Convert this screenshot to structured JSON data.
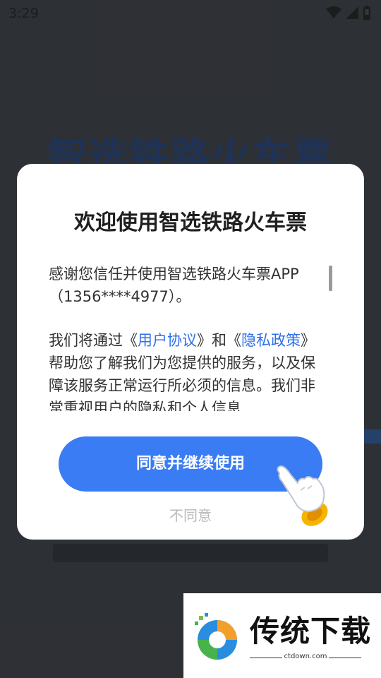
{
  "status_bar": {
    "time": "3:29",
    "icons": [
      "wifi-icon",
      "signal-icon",
      "battery-icon"
    ]
  },
  "background": {
    "app_title": "智选铁路火车票"
  },
  "dialog": {
    "title": "欢迎使用智选铁路火车票",
    "para1": "感谢您信任并使用智选铁路火车票APP（1356****4977）。",
    "para2_prefix": "我们将通过《",
    "link_user_agreement": "用户协议",
    "para2_mid": "》和《",
    "link_privacy_policy": "隐私政策",
    "para2_suffix": "》帮助您了解我们为您提供的服务，以及保障该服务正常运行所必须的信息。我们非常重视用户的隐私和个人信息",
    "agree_label": "同意并继续使用",
    "disagree_label": "不同意"
  },
  "watermark": {
    "text": "传统下载",
    "sub": "ctdown.com"
  },
  "colors": {
    "accent": "#3a7cf4",
    "link": "#2f6fea"
  }
}
